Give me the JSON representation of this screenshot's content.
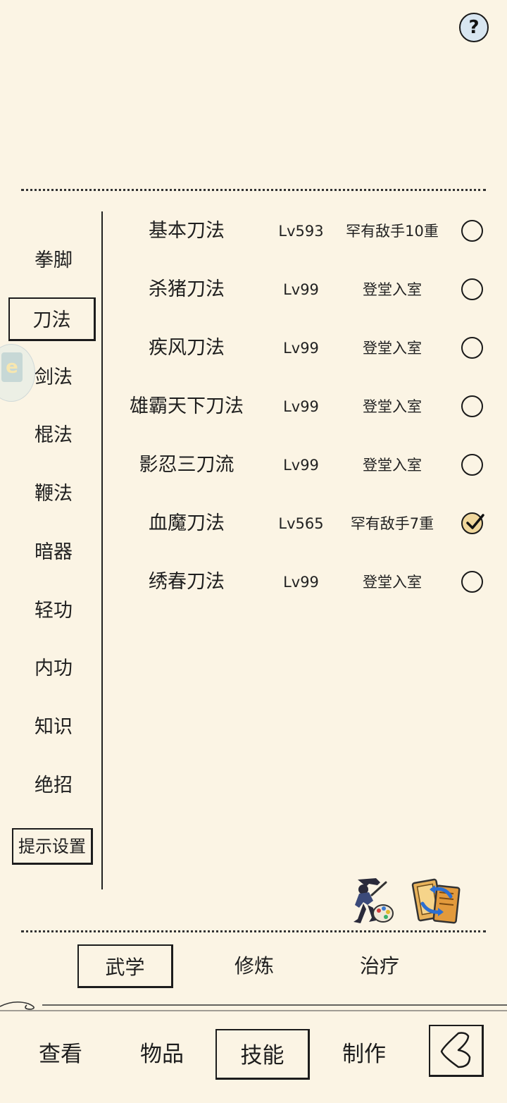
{
  "header": {
    "help_label": "?"
  },
  "categories": [
    {
      "label": "拳脚"
    },
    {
      "label": "刀法"
    },
    {
      "label": "剑法"
    },
    {
      "label": "棍法"
    },
    {
      "label": "鞭法"
    },
    {
      "label": "暗器"
    },
    {
      "label": "轻功"
    },
    {
      "label": "内功"
    },
    {
      "label": "知识"
    },
    {
      "label": "绝招"
    }
  ],
  "active_category": "刀法",
  "hint_settings_label": "提示设置",
  "side_tab_glyph": "e",
  "skills": [
    {
      "name": "基本刀法",
      "level": "Lv593",
      "rank": "罕有敌手10重",
      "selected": false
    },
    {
      "name": "杀猪刀法",
      "level": "Lv99",
      "rank": "登堂入室",
      "selected": false
    },
    {
      "name": "疾风刀法",
      "level": "Lv99",
      "rank": "登堂入室",
      "selected": false
    },
    {
      "name": "雄霸天下刀法",
      "level": "Lv99",
      "rank": "登堂入室",
      "selected": false
    },
    {
      "name": "影忍三刀流",
      "level": "Lv99",
      "rank": "登堂入室",
      "selected": false
    },
    {
      "name": "血魔刀法",
      "level": "Lv565",
      "rank": "罕有敌手7重",
      "selected": true
    },
    {
      "name": "绣春刀法",
      "level": "Lv99",
      "rank": "登堂入室",
      "selected": false
    }
  ],
  "sub_tabs": [
    {
      "label": "武学",
      "active": true
    },
    {
      "label": "修炼",
      "active": false
    },
    {
      "label": "治疗",
      "active": false
    }
  ],
  "nav": [
    {
      "label": "查看",
      "active": false
    },
    {
      "label": "物品",
      "active": false
    },
    {
      "label": "技能",
      "active": true
    },
    {
      "label": "制作",
      "active": false
    }
  ],
  "colors": {
    "background": "#fbf4e4",
    "ink": "#1d1d1d",
    "help_fill": "#d8e6f1",
    "checked_fill": "#f0d79c"
  }
}
